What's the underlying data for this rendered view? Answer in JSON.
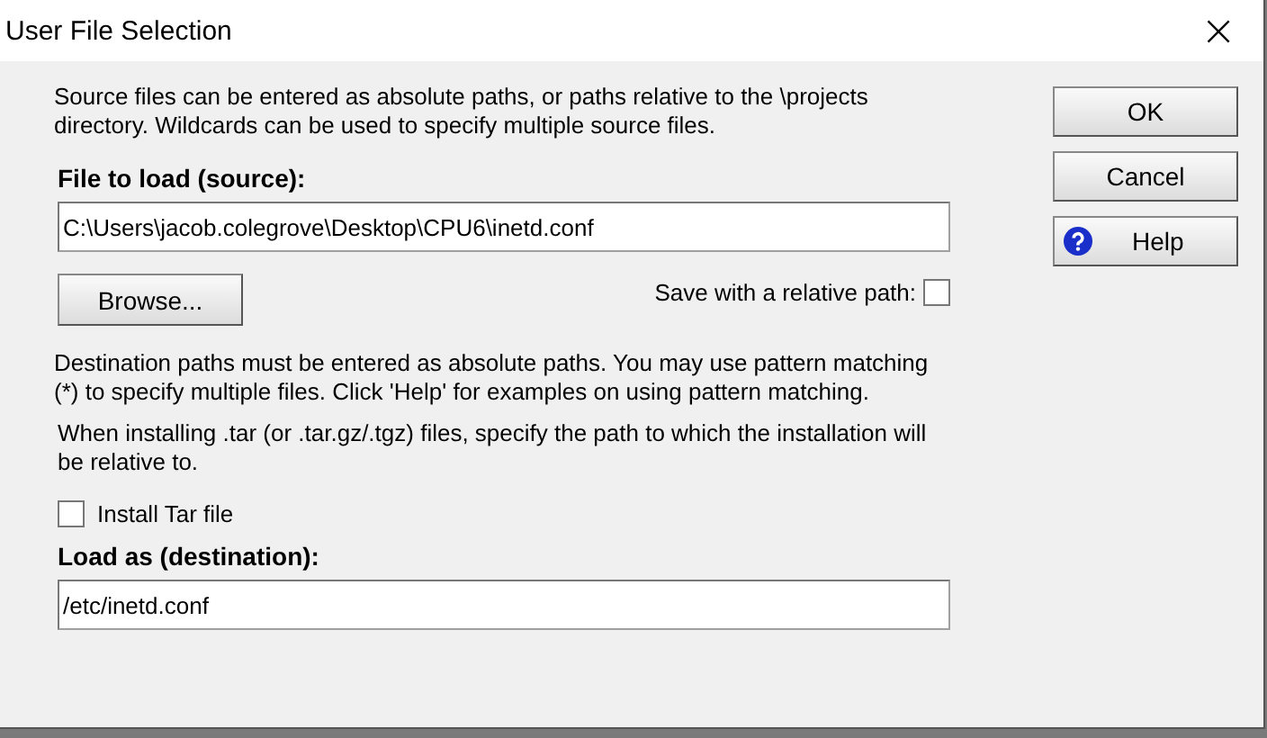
{
  "window": {
    "title": "User File Selection",
    "close": "×"
  },
  "source_note": "Source files can be entered as absolute paths, or paths relative to the \\projects directory. Wildcards can be used to specify multiple source files.",
  "source": {
    "label": "File to load (source):",
    "value": "C:\\Users\\jacob.colegrove\\Desktop\\CPU6\\inetd.conf"
  },
  "browse_button": "Browse...",
  "relative_path": {
    "label": "Save with a relative path:",
    "checked": false
  },
  "destination_note": "Destination paths must be entered as absolute paths. You may use pattern matching (*) to specify multiple files. Click 'Help' for examples on using pattern matching.",
  "tar_note": "When installing .tar (or .tar.gz/.tgz) files, specify the path to which the installation will be relative to.",
  "install_tar": {
    "label": "Install Tar file",
    "checked": false
  },
  "destination": {
    "label": "Load as (destination):",
    "value": "/etc/inetd.conf"
  },
  "buttons": [
    {
      "label": "OK",
      "kind": "plain"
    },
    {
      "label": "Cancel",
      "kind": "plain"
    },
    {
      "label": "Help",
      "kind": "help"
    }
  ]
}
